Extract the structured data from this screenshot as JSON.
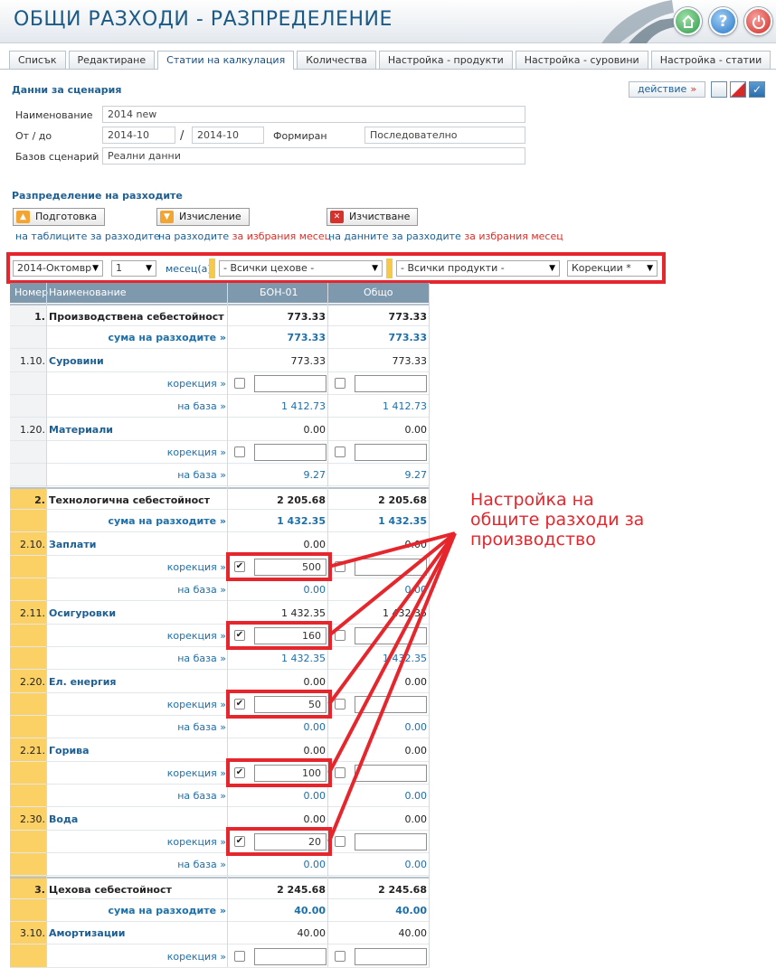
{
  "header": {
    "title": "ОБЩИ РАЗХОДИ - РАЗПРЕДЕЛЕНИЕ",
    "home_icon": "home-icon",
    "help_icon": "help-icon",
    "power_icon": "power-icon",
    "help_glyph": "?"
  },
  "tabs": [
    "Списък",
    "Редактиране",
    "Статии на калкулация",
    "Количества",
    "Настройка - продукти",
    "Настройка - суровини",
    "Настройка - статии"
  ],
  "scenario": {
    "title": "Данни за сценария",
    "action_label": "действие",
    "action_arrow": "»",
    "name_label": "Наименование",
    "name_value": "2014 new",
    "from_to_label": "От / до",
    "from_value": "2014-10",
    "slash": "/",
    "to_value": "2014-10",
    "formed_label": "Формиран",
    "formed_value": "Последователно",
    "base_label": "Базов сценарий",
    "base_value": "Реални данни"
  },
  "distribution": {
    "title": "Разпределение на разходите",
    "prep_button": "Подготовка",
    "prep_note": "на таблиците за разходите",
    "calc_button": "Изчисление",
    "calc_note_a": "на разходите ",
    "calc_note_b": "за избрания месец",
    "clear_button": "Изчистване",
    "clear_note_a": "на данните за разходите ",
    "clear_note_b": "за избрания месец"
  },
  "filters": {
    "month": "2014-Октомвр",
    "count": "1",
    "count_label": "месец(а)",
    "workshops": "- Всички цехове -",
    "products": "- Всички продукти -",
    "corrections": "Корекции *"
  },
  "table": {
    "headers": {
      "num": "Номер",
      "name": "Наименование",
      "col1": "БОН-01",
      "col2": "Общо"
    },
    "rows": [
      {
        "num": "1.",
        "name": "Производствена себестойност",
        "v1": "773.33",
        "v2": "773.33",
        "kind": "group"
      },
      {
        "num": "",
        "name": "сума на разходите »",
        "v1": "773.33",
        "v2": "773.33",
        "kind": "sum"
      },
      {
        "num": "1.10.",
        "name": "Суровини",
        "v1": "773.33",
        "v2": "773.33",
        "kind": "item"
      },
      {
        "num": "",
        "name": "корекция »",
        "c1": "",
        "c2": "",
        "checked1": false,
        "kind": "corr"
      },
      {
        "num": "",
        "name": "на база »",
        "v1": "1 412.73",
        "v2": "1 412.73",
        "kind": "base"
      },
      {
        "num": "1.20.",
        "name": "Материали",
        "v1": "0.00",
        "v2": "0.00",
        "kind": "item"
      },
      {
        "num": "",
        "name": "корекция »",
        "c1": "",
        "c2": "",
        "checked1": false,
        "kind": "corr"
      },
      {
        "num": "",
        "name": "на база »",
        "v1": "9.27",
        "v2": "9.27",
        "kind": "base"
      },
      {
        "num": "2.",
        "name": "Технологична себестойност",
        "v1": "2 205.68",
        "v2": "2 205.68",
        "kind": "group"
      },
      {
        "num": "",
        "name": "сума на разходите »",
        "v1": "1 432.35",
        "v2": "1 432.35",
        "kind": "sum"
      },
      {
        "num": "2.10.",
        "name": "Заплати",
        "v1": "0.00",
        "v2": "0.00",
        "kind": "item"
      },
      {
        "num": "",
        "name": "корекция »",
        "c1": "500",
        "c2": "",
        "checked1": true,
        "kind": "corr"
      },
      {
        "num": "",
        "name": "на база »",
        "v1": "0.00",
        "v2": "0.00",
        "kind": "base"
      },
      {
        "num": "2.11.",
        "name": "Осигуровки",
        "v1": "1 432.35",
        "v2": "1 432.35",
        "kind": "item"
      },
      {
        "num": "",
        "name": "корекция »",
        "c1": "160",
        "c2": "",
        "checked1": true,
        "kind": "corr"
      },
      {
        "num": "",
        "name": "на база »",
        "v1": "1 432.35",
        "v2": "1 432.35",
        "kind": "base"
      },
      {
        "num": "2.20.",
        "name": "Ел. енергия",
        "v1": "0.00",
        "v2": "0.00",
        "kind": "item"
      },
      {
        "num": "",
        "name": "корекция »",
        "c1": "50",
        "c2": "",
        "checked1": true,
        "kind": "corr"
      },
      {
        "num": "",
        "name": "на база »",
        "v1": "0.00",
        "v2": "0.00",
        "kind": "base"
      },
      {
        "num": "2.21.",
        "name": "Горива",
        "v1": "0.00",
        "v2": "0.00",
        "kind": "item"
      },
      {
        "num": "",
        "name": "корекция »",
        "c1": "100",
        "c2": "",
        "checked1": true,
        "kind": "corr"
      },
      {
        "num": "",
        "name": "на база »",
        "v1": "0.00",
        "v2": "0.00",
        "kind": "base"
      },
      {
        "num": "2.30.",
        "name": "Вода",
        "v1": "0.00",
        "v2": "0.00",
        "kind": "item"
      },
      {
        "num": "",
        "name": "корекция »",
        "c1": "20",
        "c2": "",
        "checked1": true,
        "kind": "corr"
      },
      {
        "num": "",
        "name": "на база »",
        "v1": "0.00",
        "v2": "0.00",
        "kind": "base"
      },
      {
        "num": "3.",
        "name": "Цехова себестойност",
        "v1": "2 245.68",
        "v2": "2 245.68",
        "kind": "group"
      },
      {
        "num": "",
        "name": "сума на разходите »",
        "v1": "40.00",
        "v2": "40.00",
        "kind": "sum"
      },
      {
        "num": "3.10.",
        "name": "Амортизации",
        "v1": "40.00",
        "v2": "40.00",
        "kind": "item"
      },
      {
        "num": "",
        "name": "корекция »",
        "c1": "",
        "c2": "",
        "checked1": false,
        "kind": "corr"
      }
    ]
  },
  "annotation": {
    "lines": [
      "Настройка на",
      "общите разходи за",
      "производство"
    ]
  },
  "colors": {
    "accent": "#1d5f92",
    "highlight": "#e5262c",
    "group_band": "#fbd166",
    "header_bg": "#7e99ae"
  }
}
